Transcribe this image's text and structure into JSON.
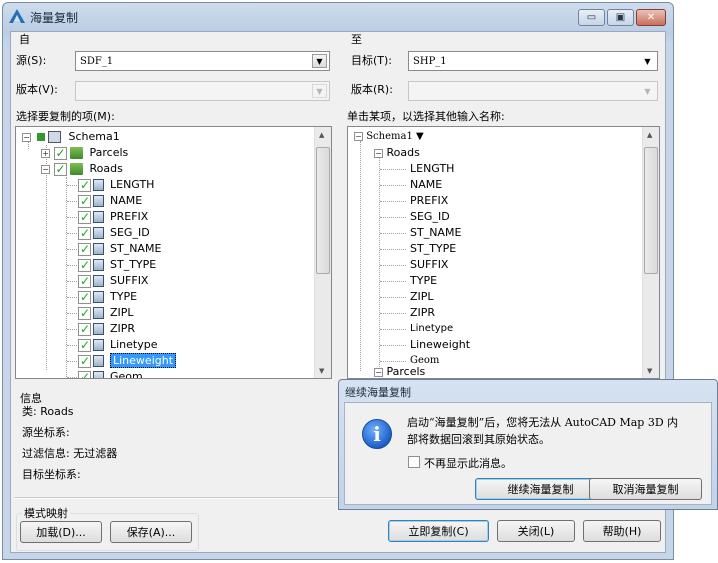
{
  "window": {
    "title": "海量复制",
    "controls": {
      "minimize": "▭",
      "restore": "▣",
      "close": "✕"
    }
  },
  "source": {
    "group_label": "自",
    "source_label": "源(S):",
    "source_value": "SDF_1",
    "version_label": "版本(V):",
    "version_value": "",
    "items_label": "选择要复制的项(M):",
    "tree": {
      "schema": "Schema1",
      "layers": [
        "Parcels",
        "Roads"
      ],
      "fields": [
        "LENGTH",
        "NAME",
        "PREFIX",
        "SEG_ID",
        "ST_NAME",
        "ST_TYPE",
        "SUFFIX",
        "TYPE",
        "ZIPL",
        "ZIPR",
        "Linetype",
        "Lineweight",
        "Geom"
      ],
      "selected_field": "Lineweight"
    }
  },
  "target": {
    "group_label": "至",
    "target_label": "目标(T):",
    "target_value": "SHP_1",
    "version_label": "版本(R):",
    "version_value": "",
    "items_label": "单击某项，以选择其他输入名称:",
    "tree": {
      "schema": "Schema1",
      "layers": [
        "Roads",
        "Parcels"
      ],
      "fields": [
        "LENGTH",
        "NAME",
        "PREFIX",
        "SEG_ID",
        "ST_NAME",
        "ST_TYPE",
        "SUFFIX",
        "TYPE",
        "ZIPL",
        "ZIPR",
        "Linetype",
        "Lineweight",
        "Geom"
      ]
    }
  },
  "info": {
    "heading": "信息",
    "class_line": "类: Roads",
    "source_crs": "源坐标系:",
    "filter_line": "过滤信息: 无过滤器",
    "target_crs": "目标坐标系:"
  },
  "schema_mapping": {
    "label": "模式映射",
    "load": "加载(D)...",
    "save": "保存(A)..."
  },
  "buttons": {
    "copy_now": "立即复制(C)",
    "close": "关闭(L)",
    "help": "帮助(H)"
  },
  "message_box": {
    "title": "继续海量复制",
    "line1": "启动“海量复制”后，您将无法从 AutoCAD Map 3D 内",
    "line2": "部将数据回滚到其原始状态。",
    "checkbox": "不再显示此消息。",
    "continue": "继续海量复制",
    "cancel": "取消海量复制"
  },
  "colors": {
    "accent": "#3399ff",
    "check": "#20a020",
    "info_icon": "#1f5fc9"
  }
}
